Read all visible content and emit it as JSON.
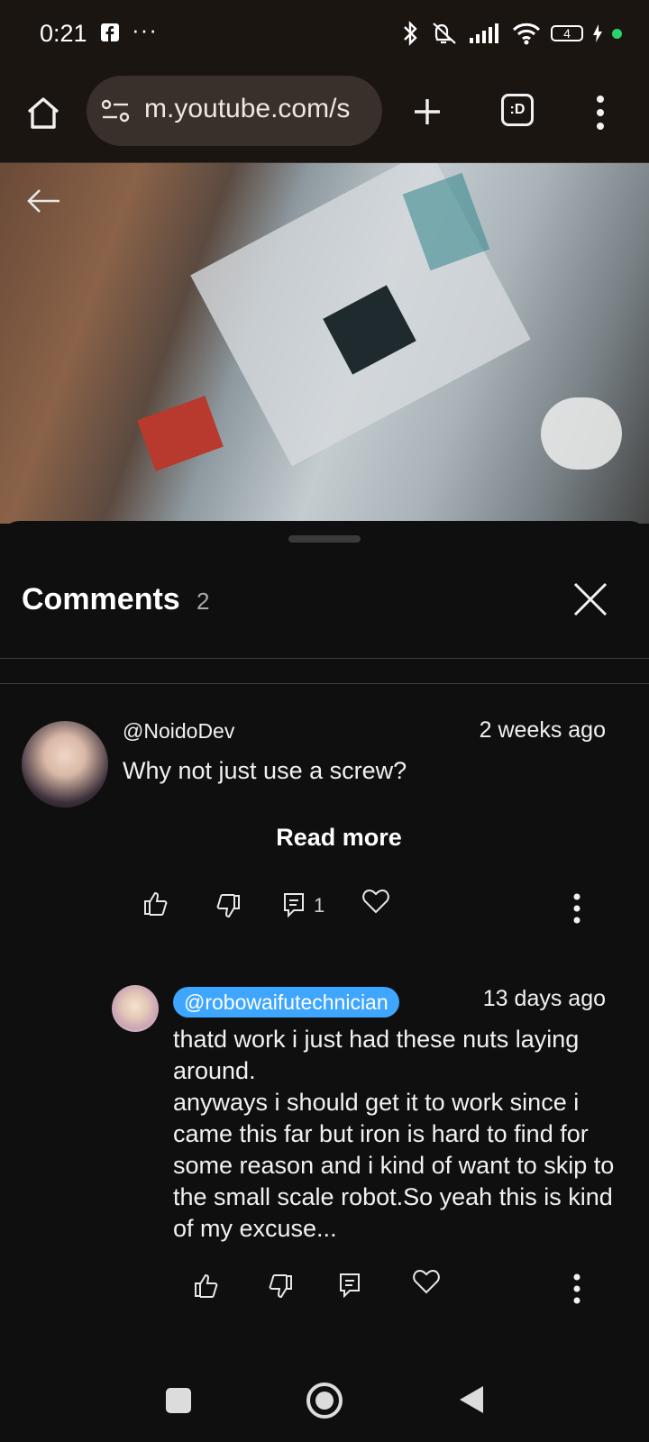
{
  "status_bar": {
    "time": "0:21",
    "more": "···",
    "battery": "4",
    "icons": [
      "facebook-icon",
      "bluetooth-icon",
      "mute-icon",
      "signal-icon",
      "wifi-icon",
      "battery-icon",
      "charging-icon",
      "green-dot"
    ]
  },
  "browser": {
    "url": "m.youtube.com/s",
    "tabs_label": ":D"
  },
  "comments_panel": {
    "title": "Comments",
    "count": "2",
    "comments": [
      {
        "author": "@NoidoDev",
        "time": "2 weeks ago",
        "text": "Why not just use a screw?",
        "read_more": "Read more",
        "reply_count": "1"
      }
    ],
    "replies": [
      {
        "author": "@robowaifutechnician",
        "time": "13 days ago",
        "text": "thatd work i just had these nuts laying around.\nanyways i should get it to work since i came this far but iron is hard to find for some reason and i kind of want to skip to the small scale robot.So yeah this is kind of my excuse..."
      }
    ]
  },
  "colors": {
    "accent_mention": "#3ea6ff",
    "background": "#0f0f0f",
    "statusbar": "#1b1512"
  }
}
